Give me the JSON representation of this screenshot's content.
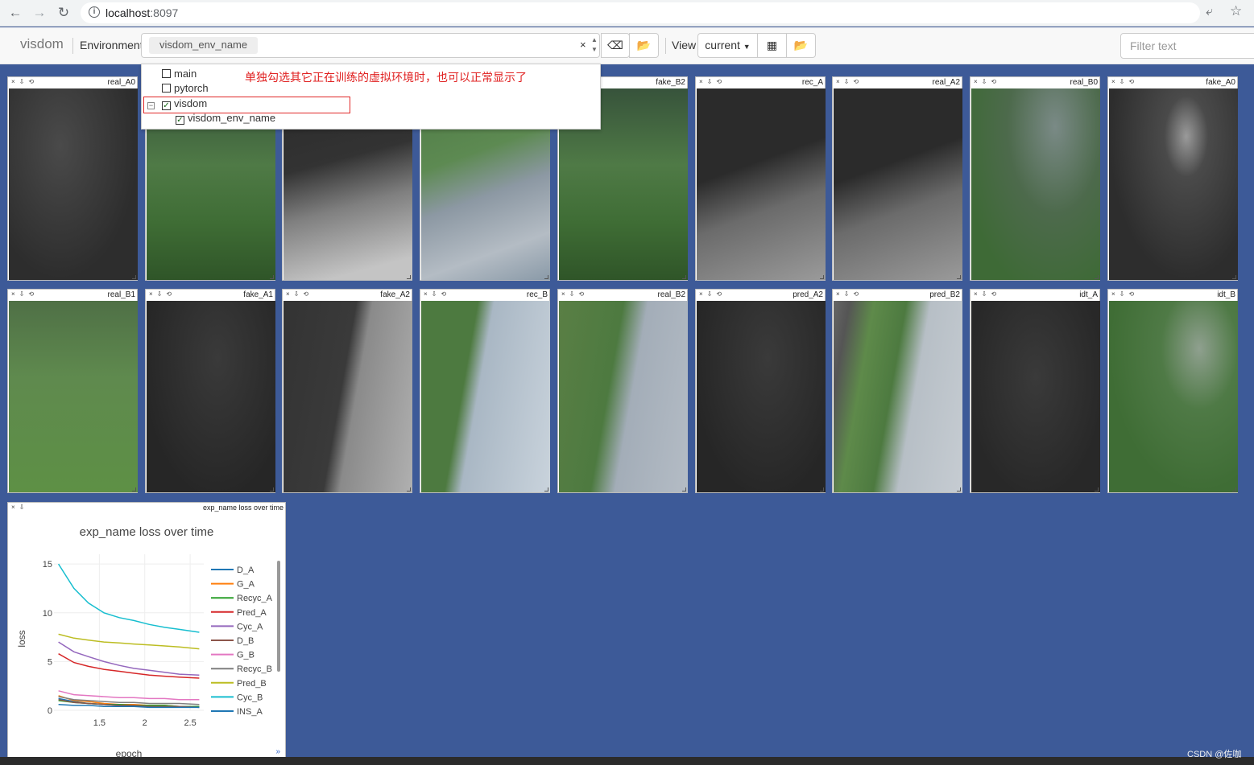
{
  "browser": {
    "url_host": "localhost",
    "url_port": ":8097"
  },
  "navbar": {
    "brand": "visdom",
    "environment_label": "Environment",
    "environment_selected": "visdom_env_name",
    "clear_symbol": "×",
    "view_label": "View",
    "view_value": "current",
    "filter_placeholder": "Filter text"
  },
  "env_dropdown": {
    "items": [
      {
        "label": "main",
        "checked": false
      },
      {
        "label": "pytorch",
        "checked": false
      },
      {
        "label": "visdom",
        "checked": true
      },
      {
        "label": "visdom_env_name",
        "checked": true
      }
    ],
    "note": "单独勾选其它正在训练的虚拟环境时，也可以正常显示了"
  },
  "panes": [
    {
      "title": "real_A0",
      "style": "dark"
    },
    {
      "title": "",
      "style": "grass"
    },
    {
      "title": "",
      "style": "grayroad"
    },
    {
      "title": "",
      "style": "grassroad"
    },
    {
      "title": "fake_B2",
      "style": "grass"
    },
    {
      "title": "rec_A",
      "style": "darkroad"
    },
    {
      "title": "real_A2",
      "style": "darkroad"
    },
    {
      "title": "real_B0",
      "style": "tree"
    },
    {
      "title": "fake_A0",
      "style": "darktree"
    },
    {
      "title": "real_B1",
      "style": "bushes"
    },
    {
      "title": "fake_A1",
      "style": "black"
    },
    {
      "title": "fake_A2",
      "style": "road3"
    },
    {
      "title": "rec_B",
      "style": "road2"
    },
    {
      "title": "real_B2",
      "style": "road4"
    },
    {
      "title": "pred_A2",
      "style": "black"
    },
    {
      "title": "pred_B2",
      "style": "pred"
    },
    {
      "title": "idt_A",
      "style": "idtA"
    },
    {
      "title": "idt_B",
      "style": "idtB"
    }
  ],
  "loss_pane": {
    "window_title": "exp_name loss over time"
  },
  "chart_data": {
    "type": "line",
    "title": "exp_name loss over time",
    "xlabel": "epoch",
    "ylabel": "loss",
    "xlim": [
      1.0,
      2.65
    ],
    "ylim": [
      0,
      16
    ],
    "xticks": [
      "1.5",
      "2",
      "2.5"
    ],
    "yticks": [
      "0",
      "5",
      "10",
      "15"
    ],
    "grid": true,
    "legend_position": "right",
    "series": [
      {
        "name": "D_A",
        "color": "#1f77b4",
        "values": [
          1.2,
          0.9,
          0.7,
          0.6,
          0.5,
          0.5,
          0.4,
          0.4,
          0.4,
          0.3
        ]
      },
      {
        "name": "G_A",
        "color": "#ff7f0e",
        "values": [
          1.5,
          1.0,
          0.9,
          0.7,
          0.6,
          0.6,
          0.5,
          0.5,
          0.4,
          0.4
        ]
      },
      {
        "name": "Recyc_A",
        "color": "#2ca02c",
        "values": [
          1.0,
          0.8,
          0.7,
          0.6,
          0.6,
          0.5,
          0.5,
          0.5,
          0.4,
          0.4
        ]
      },
      {
        "name": "Pred_A",
        "color": "#d62728",
        "values": [
          5.8,
          4.9,
          4.5,
          4.2,
          4.0,
          3.8,
          3.6,
          3.5,
          3.4,
          3.3
        ]
      },
      {
        "name": "Cyc_A",
        "color": "#9467bd",
        "values": [
          7.0,
          6.0,
          5.5,
          5.0,
          4.6,
          4.3,
          4.1,
          3.9,
          3.7,
          3.6
        ]
      },
      {
        "name": "D_B",
        "color": "#8c564b",
        "values": [
          1.1,
          0.8,
          0.7,
          0.6,
          0.5,
          0.5,
          0.4,
          0.4,
          0.4,
          0.3
        ]
      },
      {
        "name": "G_B",
        "color": "#e377c2",
        "values": [
          2.0,
          1.6,
          1.5,
          1.4,
          1.3,
          1.3,
          1.2,
          1.2,
          1.1,
          1.1
        ]
      },
      {
        "name": "Recyc_B",
        "color": "#7f7f7f",
        "values": [
          1.4,
          1.1,
          1.0,
          0.9,
          0.8,
          0.8,
          0.7,
          0.7,
          0.7,
          0.6
        ]
      },
      {
        "name": "Pred_B",
        "color": "#bcbd22",
        "values": [
          7.8,
          7.4,
          7.2,
          7.0,
          6.9,
          6.8,
          6.7,
          6.6,
          6.5,
          6.3
        ]
      },
      {
        "name": "Cyc_B",
        "color": "#17becf",
        "values": [
          15.0,
          12.5,
          11.0,
          10.0,
          9.5,
          9.2,
          8.8,
          8.5,
          8.3,
          8.0
        ]
      },
      {
        "name": "INS_A",
        "color": "#1f77b4",
        "values": [
          0.6,
          0.5,
          0.5,
          0.4,
          0.4,
          0.4,
          0.3,
          0.3,
          0.3,
          0.3
        ]
      }
    ],
    "x": [
      1.05,
      1.22,
      1.38,
      1.55,
      1.72,
      1.88,
      2.05,
      2.22,
      2.38,
      2.6
    ]
  },
  "watermark": "CSDN @佐咖"
}
